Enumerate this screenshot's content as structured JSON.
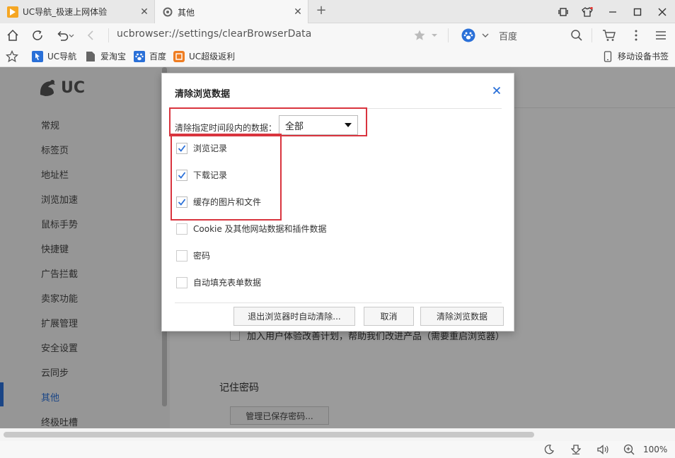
{
  "tabs": [
    {
      "title": "UC导航_极速上网体验",
      "close": "✕"
    },
    {
      "title": "其他",
      "close": "✕"
    }
  ],
  "newtab": "+",
  "toolbar": {
    "url": "ucbrowser://settings/clearBrowserData",
    "search_engine": "百度"
  },
  "bookmarks": {
    "items": [
      "UC导航",
      "爱淘宝",
      "百度",
      "UC超级返利"
    ],
    "mobile": "移动设备书签"
  },
  "sidebar": {
    "logo": "UC",
    "items": [
      "常规",
      "标签页",
      "地址栏",
      "浏览加速",
      "鼠标手势",
      "快捷键",
      "广告拦截",
      "卖家功能",
      "扩展管理",
      "安全设置",
      "云同步",
      "其他",
      "终极吐槽"
    ],
    "active_index": 11
  },
  "content": {
    "hidden_option": "加入用户体验改善计划，帮助我们改进产品（需要重启浏览器）",
    "section_title": "记住密码",
    "manage_button": "管理已保存密码..."
  },
  "dialog": {
    "title": "清除浏览数据",
    "close": "✕",
    "range_label": "清除指定时间段内的数据：",
    "range_value": "全部",
    "options": [
      {
        "label": "浏览记录",
        "checked": true
      },
      {
        "label": "下载记录",
        "checked": true
      },
      {
        "label": "缓存的图片和文件",
        "checked": true
      },
      {
        "label": "Cookie 及其他网站数据和插件数据",
        "checked": false
      },
      {
        "label": "密码",
        "checked": false
      },
      {
        "label": "自动填充表单数据",
        "checked": false
      }
    ],
    "buttons": {
      "auto_clear": "退出浏览器时自动清除...",
      "cancel": "取消",
      "clear": "清除浏览数据"
    }
  },
  "status": {
    "zoom": "100%"
  },
  "colors": {
    "accent": "#2a70d8",
    "highlight": "#d9343e"
  }
}
